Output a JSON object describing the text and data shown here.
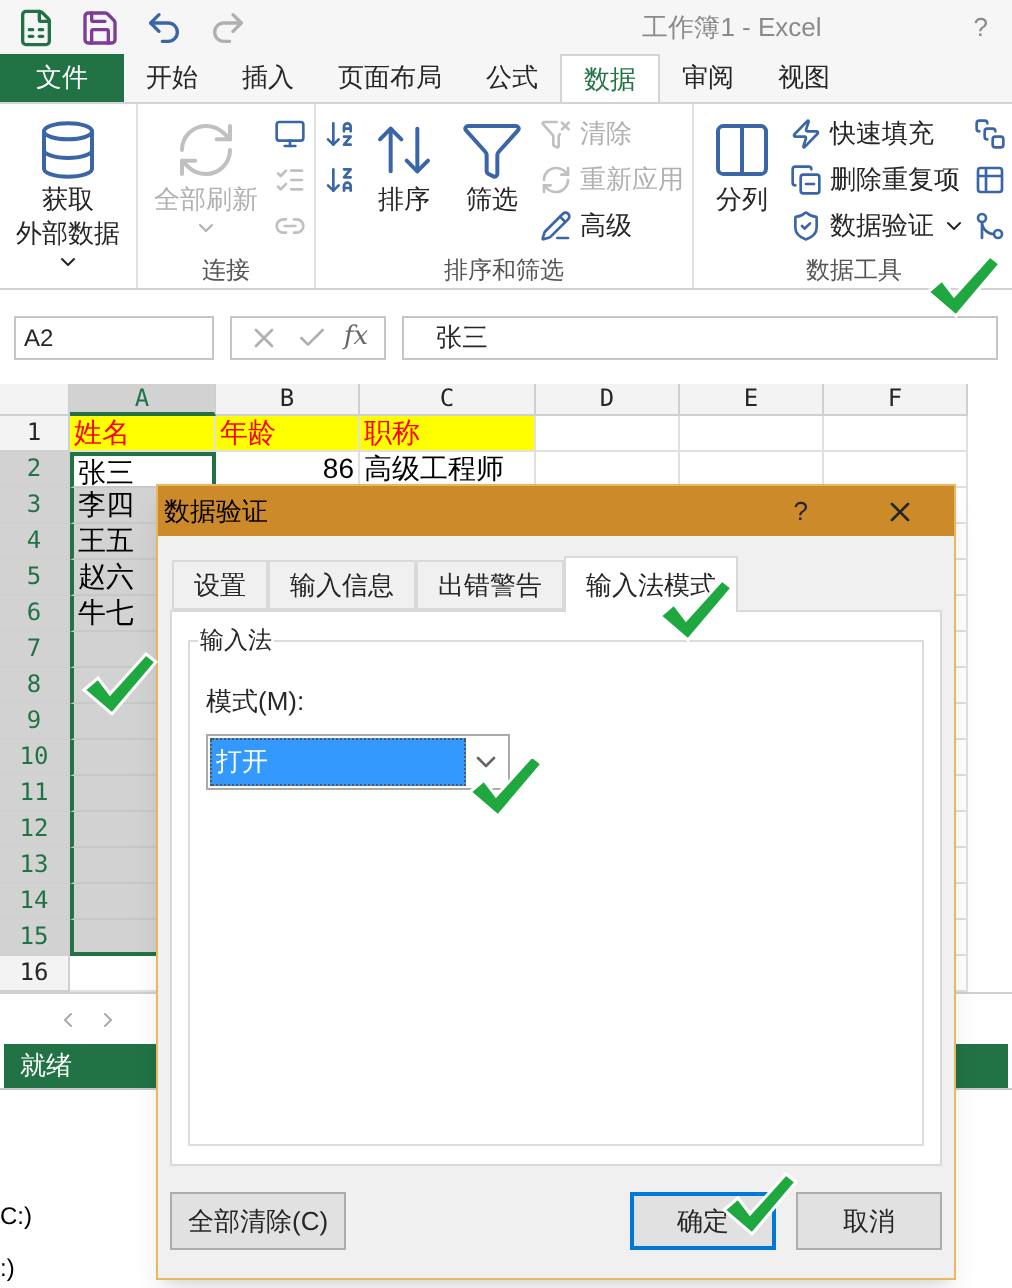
{
  "window": {
    "title": "工作簿1 - Excel",
    "help": "?"
  },
  "file_button": {
    "label": "文件"
  },
  "tabs": [
    {
      "label": "开始",
      "selected": false
    },
    {
      "label": "插入",
      "selected": false
    },
    {
      "label": "页面布局",
      "selected": false
    },
    {
      "label": "公式",
      "selected": false
    },
    {
      "label": "数据",
      "selected": true
    },
    {
      "label": "审阅",
      "selected": false
    },
    {
      "label": "视图",
      "selected": false
    }
  ],
  "ribbon": {
    "groups": [
      {
        "columns": [
          [
            {
              "kind": "large",
              "label_lines": [
                "获取",
                "外部数据"
              ],
              "dropdown": true,
              "disabled": false
            }
          ]
        ]
      },
      {
        "label": "连接",
        "columns": [
          [
            {
              "kind": "large",
              "label": "全部刷新",
              "dropdown": true,
              "disabled": true
            }
          ],
          [
            {
              "kind": "icon",
              "disabled": false
            },
            {
              "kind": "icon",
              "disabled": true
            },
            {
              "kind": "icon",
              "disabled": true
            }
          ]
        ]
      },
      {
        "label": "排序和筛选",
        "columns": [
          [
            {
              "kind": "icon",
              "disabled": false
            },
            {
              "kind": "icon",
              "disabled": false
            }
          ],
          [
            {
              "kind": "large",
              "label": "排序",
              "dropdown": false,
              "disabled": false
            }
          ],
          [
            {
              "kind": "large",
              "label": "筛选",
              "dropdown": false,
              "disabled": false
            }
          ],
          [
            {
              "kind": "small",
              "label": "清除",
              "disabled": true
            },
            {
              "kind": "small",
              "label": "重新应用",
              "disabled": true
            },
            {
              "kind": "small",
              "label": "高级",
              "disabled": false
            }
          ]
        ]
      },
      {
        "label": "数据工具",
        "columns": [
          [
            {
              "kind": "large",
              "label": "分列",
              "dropdown": false,
              "disabled": false
            }
          ],
          [
            {
              "kind": "small",
              "label": "快速填充",
              "disabled": false
            },
            {
              "kind": "small",
              "label": "删除重复项",
              "disabled": false
            },
            {
              "kind": "small",
              "label": "数据验证",
              "dropdown": true,
              "disabled": false
            }
          ],
          [
            {
              "kind": "icon",
              "disabled": false
            },
            {
              "kind": "icon",
              "disabled": false
            },
            {
              "kind": "icon",
              "disabled": false
            }
          ]
        ]
      }
    ]
  },
  "formula_bar": {
    "name_box": "A2",
    "function_button": "fx",
    "formula": "张三"
  },
  "sheet": {
    "columns": [
      {
        "label": "A",
        "selected": true
      },
      {
        "label": "B",
        "selected": false
      },
      {
        "label": "C",
        "selected": false
      },
      {
        "label": "D",
        "selected": false
      },
      {
        "label": "E",
        "selected": false
      },
      {
        "label": "F",
        "selected": false
      }
    ],
    "rows": [
      {
        "header": "1",
        "kind": "title",
        "selected": false,
        "active": false,
        "cells": [
          {
            "text": "姓名"
          },
          {
            "text": "年龄"
          },
          {
            "text": "职称"
          }
        ]
      },
      {
        "header": "2",
        "kind": "data",
        "selected": true,
        "active": true,
        "cells": [
          {
            "text": "张三"
          },
          {
            "text": "86",
            "kind": "number"
          },
          {
            "text": "高级工程师"
          }
        ]
      },
      {
        "header": "3",
        "kind": "data",
        "selected": true,
        "active": false,
        "cells": [
          {
            "text": "李四"
          }
        ]
      },
      {
        "header": "4",
        "kind": "data",
        "selected": true,
        "active": false,
        "cells": [
          {
            "text": "王五"
          }
        ]
      },
      {
        "header": "5",
        "kind": "data",
        "selected": true,
        "active": false,
        "cells": [
          {
            "text": "赵六"
          }
        ]
      },
      {
        "header": "6",
        "kind": "data",
        "selected": true,
        "active": false,
        "cells": [
          {
            "text": "牛七"
          }
        ]
      },
      {
        "header": "7",
        "kind": "data",
        "selected": true,
        "active": false,
        "cells": []
      },
      {
        "header": "8",
        "kind": "data",
        "selected": true,
        "active": false,
        "cells": []
      },
      {
        "header": "9",
        "kind": "data",
        "selected": true,
        "active": false,
        "cells": []
      },
      {
        "header": "10",
        "kind": "data",
        "selected": true,
        "active": false,
        "cells": []
      },
      {
        "header": "11",
        "kind": "data",
        "selected": true,
        "active": false,
        "cells": []
      },
      {
        "header": "12",
        "kind": "data",
        "selected": true,
        "active": false,
        "cells": []
      },
      {
        "header": "13",
        "kind": "data",
        "selected": true,
        "active": false,
        "cells": []
      },
      {
        "header": "14",
        "kind": "data",
        "selected": true,
        "active": false,
        "cells": []
      },
      {
        "header": "15",
        "kind": "data",
        "selected": true,
        "active": false,
        "cells": []
      },
      {
        "header": "16",
        "kind": "data",
        "selected": false,
        "active": false,
        "cells": []
      }
    ]
  },
  "status_bar": {
    "text": "就绪"
  },
  "background_texts": [
    "C:)",
    ":)"
  ],
  "dialog": {
    "title": "数据验证",
    "help": "?",
    "tabs": [
      {
        "label": "设置",
        "selected": false
      },
      {
        "label": "输入信息",
        "selected": false
      },
      {
        "label": "出错警告",
        "selected": false
      },
      {
        "label": "输入法模式",
        "selected": true
      }
    ],
    "group_label": "输入法",
    "field_label": "模式(M):",
    "mode": {
      "value": "打开",
      "selected": true
    },
    "buttons": [
      {
        "label": "全部清除(C)",
        "default": false
      },
      {
        "label": "确定",
        "default": true
      },
      {
        "label": "取消",
        "default": false
      }
    ]
  }
}
